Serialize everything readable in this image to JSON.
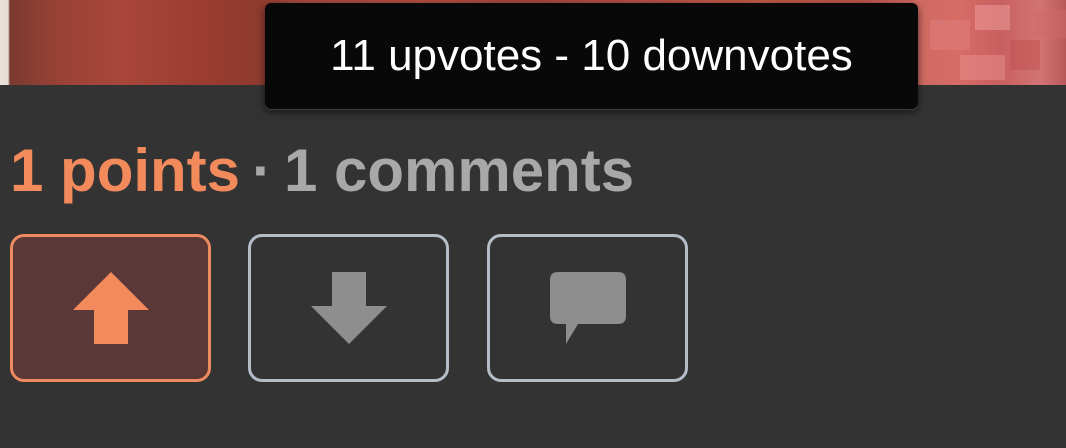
{
  "tooltip": {
    "text": "11 upvotes - 10 downvotes"
  },
  "stats": {
    "points": "1 points",
    "separator": "·",
    "comments": "1 comments"
  },
  "actions": [
    {
      "name": "upvote",
      "icon": "arrow-up-icon",
      "active": true,
      "color": "#f28a5c"
    },
    {
      "name": "downvote",
      "icon": "arrow-down-icon",
      "active": false,
      "color": "#8e8e8e"
    },
    {
      "name": "comment",
      "icon": "speech-bubble-icon",
      "active": false,
      "color": "#8e8e8e"
    }
  ],
  "colors": {
    "background": "#333333",
    "accent": "#f28a5c",
    "muted_text": "#a8a8a8",
    "button_border": "#b4bcc8"
  }
}
